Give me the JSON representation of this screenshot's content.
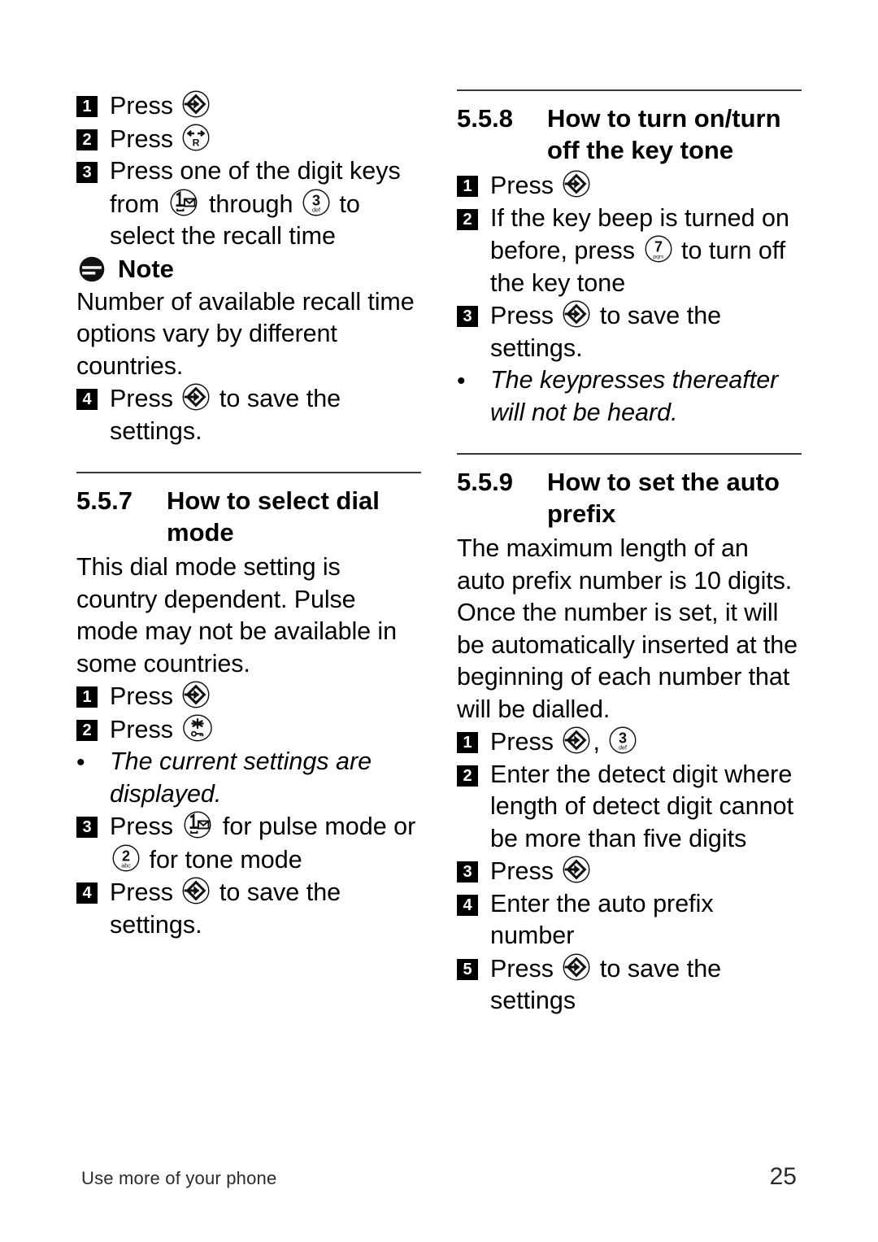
{
  "document": {
    "footer_text": "Use more of your phone",
    "page_number": "25"
  },
  "icons": {
    "menu_key": "menu-select-key-icon",
    "recall_key": "recall-r-key-icon",
    "key_1": "digit-1-voicemail-key-icon",
    "key_2": "digit-2-abc-key-icon",
    "key_3": "digit-3-def-key-icon",
    "key_7": "digit-7-pqrs-key-icon",
    "star_key": "star-keylock-key-icon",
    "note": "note-icon"
  },
  "left_column": {
    "steps_top": [
      {
        "num": "1",
        "pre": "Press ",
        "post": ""
      },
      {
        "num": "2",
        "pre": "Press ",
        "post": ""
      },
      {
        "num": "3",
        "pre": "Press one of the digit keys from ",
        "mid": " through ",
        "post": " to select the recall time"
      }
    ],
    "note": {
      "title": "Note",
      "body": "Number of available recall time options vary by different countries."
    },
    "step4": {
      "num": "4",
      "pre": "Press ",
      "post": " to save the settings."
    },
    "section": {
      "number": "5.5.7",
      "title": "How to select dial mode",
      "intro": "This dial mode setting is country dependent.  Pulse mode may not be available in some countries.",
      "steps": [
        {
          "num": "1",
          "pre": "Press ",
          "post": ""
        },
        {
          "num": "2",
          "pre": "Press ",
          "post": ""
        }
      ],
      "bullet": "The current settings are displayed.",
      "step3": {
        "num": "3",
        "pre": "Press ",
        "mid": " for pulse mode or ",
        "post": " for tone mode"
      },
      "step4": {
        "num": "4",
        "pre": "Press ",
        "post": " to save the settings."
      }
    }
  },
  "right_column": {
    "section558": {
      "number": "5.5.8",
      "title": "How to turn on/turn off the key tone",
      "step1": {
        "num": "1",
        "pre": "Press ",
        "post": ""
      },
      "step2": {
        "num": "2",
        "pre": "If the key beep is turned on before, press ",
        "post": " to turn off the key tone"
      },
      "step3": {
        "num": "3",
        "pre": "Press ",
        "post": " to save the settings."
      },
      "bullet": "The keypresses thereafter will not be heard."
    },
    "section559": {
      "number": "5.5.9",
      "title": "How to set the auto prefix",
      "intro": "The maximum length of an auto prefix number is 10 digits. Once the number is set, it will be automatically inserted at the beginning of each number that will be dialled.",
      "step1": {
        "num": "1",
        "pre": "Press ",
        "mid": ", ",
        "post": ""
      },
      "step2": {
        "num": "2",
        "text": "Enter the detect digit where length of detect digit cannot be more than five digits"
      },
      "step3": {
        "num": "3",
        "pre": "Press ",
        "post": ""
      },
      "step4": {
        "num": "4",
        "text": "Enter the auto prefix number"
      },
      "step5": {
        "num": "5",
        "pre": "Press ",
        "post": " to save the settings"
      }
    }
  }
}
